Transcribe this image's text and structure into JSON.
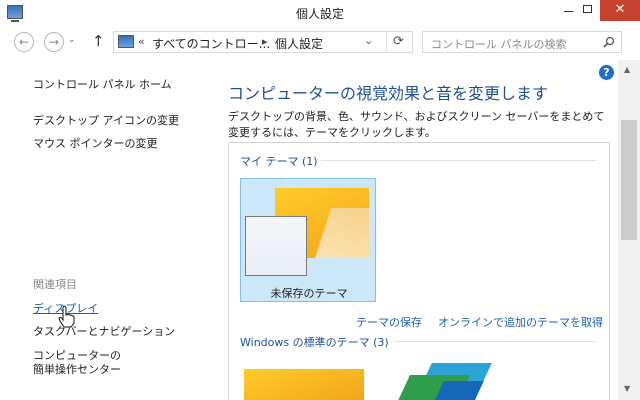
{
  "window": {
    "title": "個人設定",
    "min_glyph": "",
    "max_glyph": "",
    "close_glyph": "✕"
  },
  "nav": {
    "back_glyph": "←",
    "forward_glyph": "→",
    "history_glyph": "⌄",
    "up_glyph": "↑"
  },
  "address": {
    "chevron": "«",
    "crumb1": "すべてのコントロー...",
    "crumb_sep": "▸",
    "crumb2": "個人設定",
    "dropdown_glyph": "⌄",
    "refresh_glyph": "⟳"
  },
  "search": {
    "placeholder": "コントロール パネルの検索"
  },
  "sidebar": {
    "home": "コントロール パネル ホーム",
    "desktop_icons": "デスクトップ アイコンの変更",
    "mouse_pointer": "マウス ポインターの変更",
    "related_heading": "関連項目",
    "display": "ディスプレイ",
    "taskbar": "タスクバーとナビゲーション",
    "ease1": "コンピューターの",
    "ease2": "簡単操作センター"
  },
  "help_glyph": "?",
  "main": {
    "title": "コンピューターの視覚効果と音を変更します",
    "description": "デスクトップの背景、色、サウンド、およびスクリーン セーバーをまとめて変更するには、テーマをクリックします。"
  },
  "themes": {
    "my_themes_label": "マイ テーマ (1)",
    "unsaved_theme": "未保存のテーマ",
    "save_theme": "テーマの保存",
    "get_more_online": "オンラインで追加のテーマを取得",
    "windows_themes_label": "Windows の標準のテーマ (3)"
  },
  "scrollbar": {
    "up_glyph": "▲",
    "down_glyph": "▼"
  },
  "colors": {
    "accent_blue": "#1a5fb4",
    "heading_blue": "#1e4f99",
    "selected_tile": "#cce8f8",
    "close_red": "#c7412f"
  }
}
